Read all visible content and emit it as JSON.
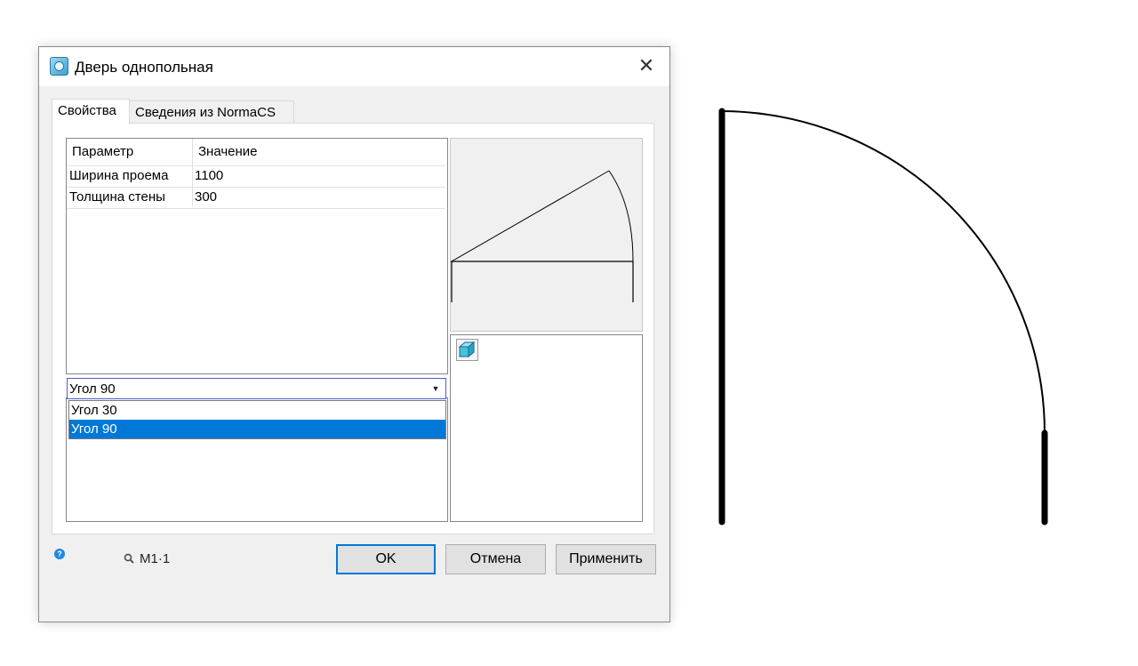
{
  "dialog": {
    "title": "Дверь однопольная",
    "tabs": [
      {
        "label": "Свойства",
        "active": true
      },
      {
        "label": "Сведения из NormaCS",
        "active": false
      }
    ],
    "grid": {
      "columns": [
        "Параметр",
        "Значение"
      ],
      "rows": [
        {
          "param": "Ширина проема",
          "value": "1100"
        },
        {
          "param": "Толщина стены",
          "value": "300"
        }
      ]
    },
    "combo": {
      "value": "Угол 90",
      "options": [
        "Угол 30",
        "Угол 90"
      ],
      "selected_index": 1
    },
    "footer": {
      "scale": "M1·1",
      "ok_label": "OK",
      "cancel_label": "Отмена",
      "apply_label": "Применить"
    }
  },
  "icons": [
    "app-icon",
    "close-icon",
    "help-icon",
    "zoom-icon",
    "cube-3d-icon",
    "chevron-down-icon"
  ],
  "colors": {
    "accent": "#0078d7",
    "dialog_bg": "#f0f0f0",
    "selection_bg": "#0078d7"
  }
}
